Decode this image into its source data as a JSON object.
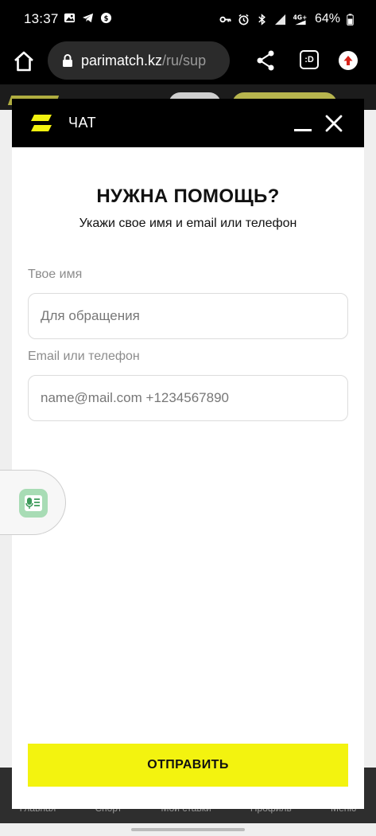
{
  "status_bar": {
    "time": "13:37",
    "network": "4G+",
    "battery": "64%"
  },
  "browser": {
    "url_domain": "parimatch.kz",
    "url_path": "/ru/sup",
    "tabs_label": ":D"
  },
  "chat": {
    "header_title": "ЧАТ",
    "heading": "НУЖНА ПОМОЩЬ?",
    "subheading": "Укажи свое имя и email или телефон",
    "name_label": "Твое имя",
    "name_placeholder": "Для обращения",
    "contact_label": "Email или телефон",
    "contact_placeholder": "name@mail.com +1234567890",
    "submit_label": "ОТПРАВИТЬ"
  },
  "background_nav": {
    "items": [
      "Главная",
      "Спорт",
      "Мои ставки",
      "Профиль",
      "Меню"
    ]
  },
  "colors": {
    "accent_yellow": "#f3f30f",
    "header_black": "#000000",
    "voice_widget_green": "#a8dcb5"
  }
}
